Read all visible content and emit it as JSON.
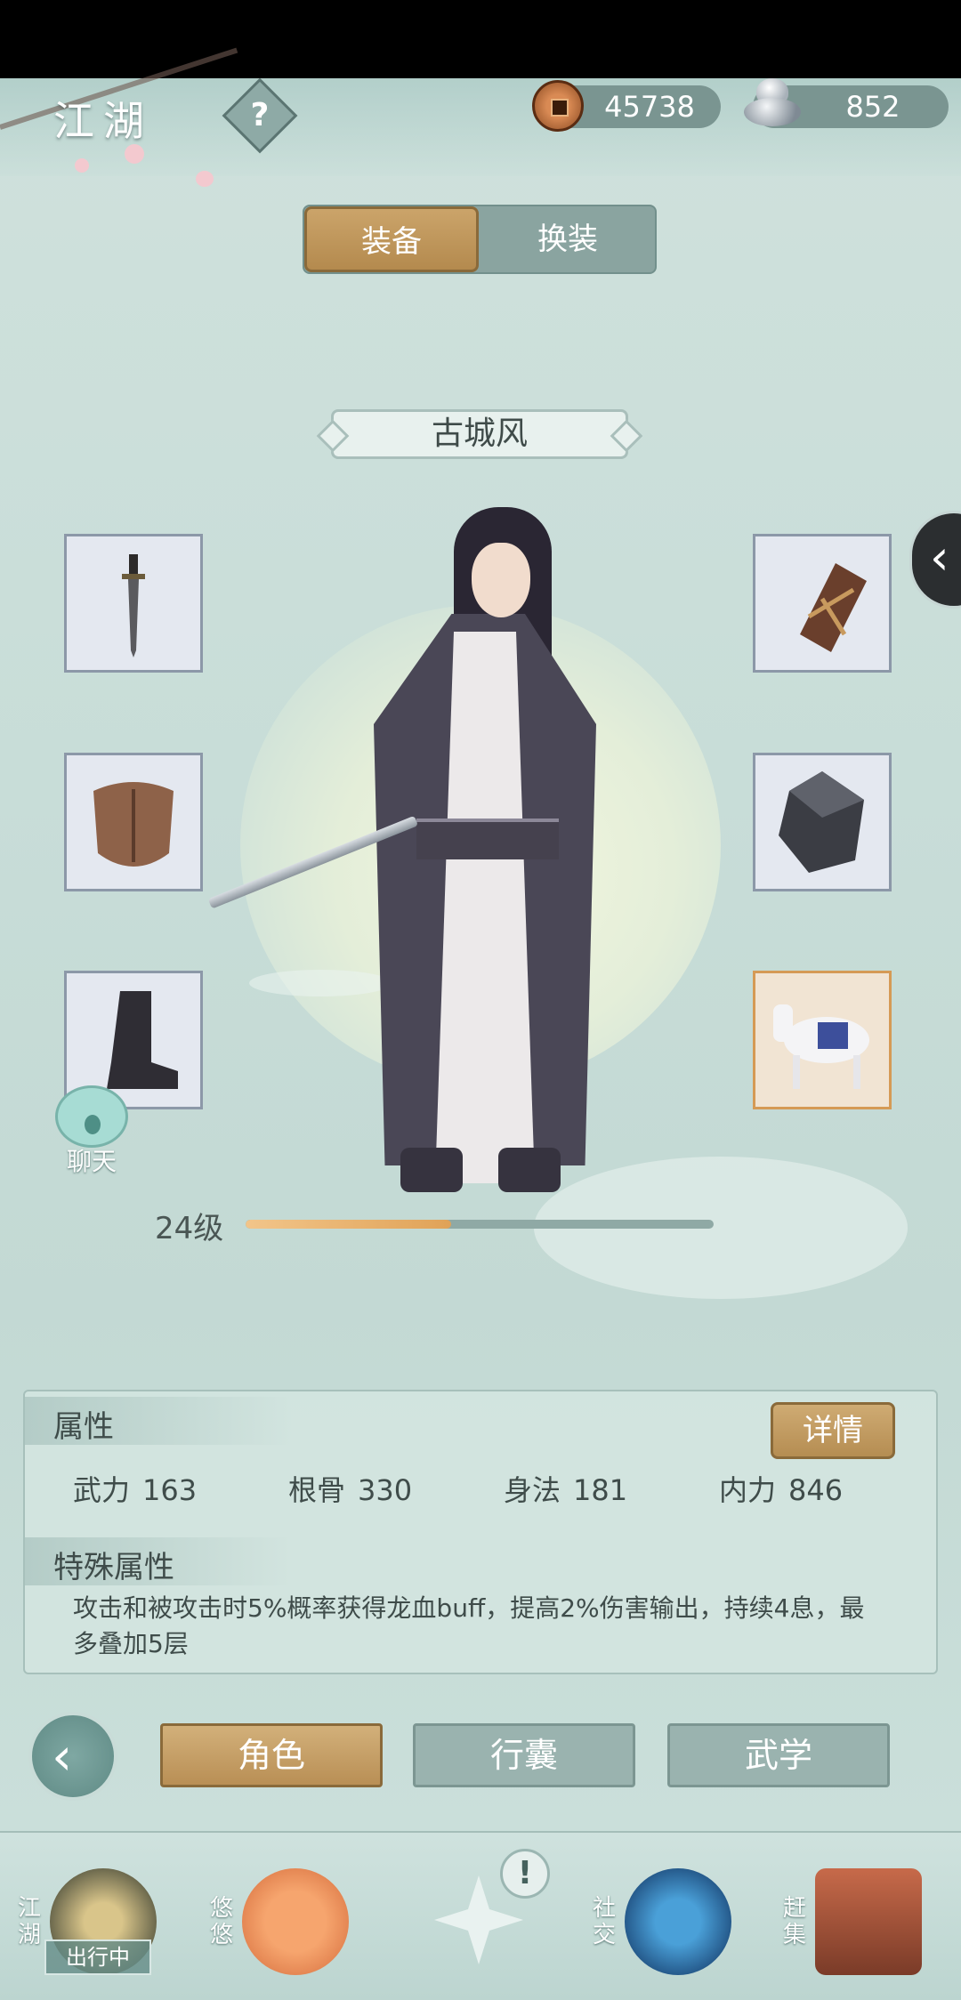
{
  "header": {
    "title": "江湖",
    "help_icon": "question-mark-icon",
    "currency": [
      {
        "name": "copper-coin",
        "value": "45738"
      },
      {
        "name": "silver-ingot",
        "value": "852"
      }
    ]
  },
  "tabs": [
    {
      "label": "装备",
      "active": true
    },
    {
      "label": "换装",
      "active": false
    }
  ],
  "character": {
    "name": "古城风",
    "level_label": "24级",
    "xp_progress": 0.44
  },
  "equipment": {
    "left": [
      {
        "icon": "sword-icon"
      },
      {
        "icon": "leather-armor-icon"
      },
      {
        "icon": "boot-icon"
      }
    ],
    "right": [
      {
        "icon": "bracer-icon"
      },
      {
        "icon": "gem-icon"
      },
      {
        "icon": "white-horse-icon",
        "highlight": true
      }
    ]
  },
  "chat": {
    "label": "聊天"
  },
  "attributes": {
    "title": "属性",
    "detail_button": "详情",
    "stats": [
      {
        "label": "武力",
        "value": "163"
      },
      {
        "label": "根骨",
        "value": "330"
      },
      {
        "label": "身法",
        "value": "181"
      },
      {
        "label": "内力",
        "value": "846"
      }
    ],
    "special_title": "特殊属性",
    "special_desc": "攻击和被攻击时5%概率获得龙血buff，提高2%伤害输出，持续4息，最多叠加5层"
  },
  "nav": {
    "back_icon": "back-arrow-icon",
    "buttons": [
      {
        "label": "角色",
        "active": true
      },
      {
        "label": "行囊",
        "active": false
      },
      {
        "label": "武学",
        "active": false
      }
    ]
  },
  "dock": {
    "items": [
      {
        "label": "江湖",
        "badge": "出行中"
      },
      {
        "label": "悠悠"
      },
      {
        "label": ""
      },
      {
        "label": "社交"
      },
      {
        "label": "赶集"
      }
    ],
    "alert": "!"
  },
  "colors": {
    "background": "#c9ddd8",
    "gold_accent": "#b98f55",
    "teal_button": "#9ab3af"
  }
}
